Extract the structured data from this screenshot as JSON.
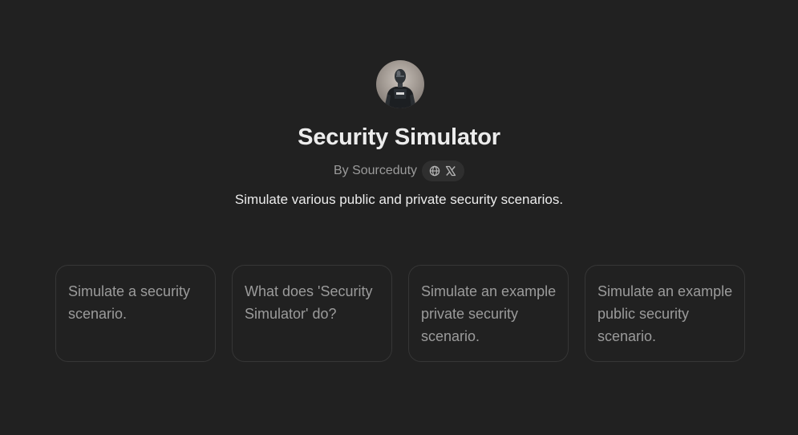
{
  "gpt": {
    "avatar_icon": "robot-police-avatar",
    "title": "Security Simulator",
    "byline": "By Sourceduty",
    "description": "Simulate various public and private security scenarios.",
    "social_icons": [
      "globe-icon",
      "x-logo-icon"
    ]
  },
  "conversation_starters": [
    {
      "text": "Simulate a security scenario."
    },
    {
      "text": "What does 'Security Simulator' do?"
    },
    {
      "text": "Simulate an example private security scenario."
    },
    {
      "text": "Simulate an example public security scenario."
    }
  ],
  "colors": {
    "background": "#212121",
    "title": "#ececec",
    "muted_text": "#9b9b9b",
    "card_border": "#363636",
    "pill_background": "#2f2f2f"
  }
}
